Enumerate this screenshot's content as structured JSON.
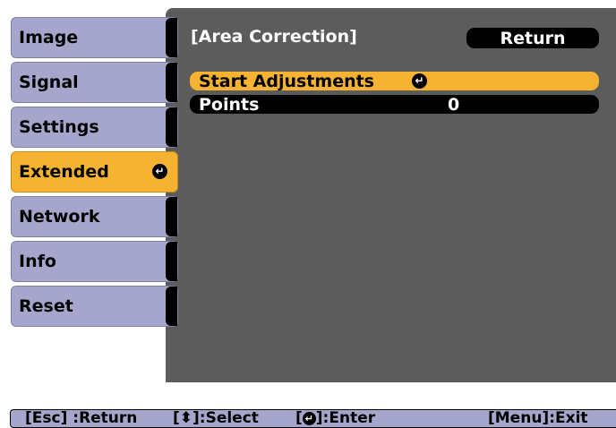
{
  "sidebar": {
    "tabs": [
      {
        "label": "Image"
      },
      {
        "label": "Signal"
      },
      {
        "label": "Settings"
      },
      {
        "label": "Extended",
        "active": true
      },
      {
        "label": "Network"
      },
      {
        "label": "Info"
      },
      {
        "label": "Reset"
      }
    ]
  },
  "panel": {
    "title": "[Area Correction]",
    "return_label": "Return",
    "rows": [
      {
        "label": "Start Adjustments",
        "value": ""
      },
      {
        "label": "Points",
        "value": "0"
      }
    ]
  },
  "help": {
    "esc": "[Esc] :Return",
    "select": "[⬍]:Select",
    "enter_prefix": "[",
    "enter_suffix": "]:Enter",
    "menu": "[Menu]:Exit"
  },
  "icons": {
    "enter": "enter-icon"
  },
  "colors": {
    "accent": "#f5b331",
    "tab": "#a6a6cc",
    "panel": "#5c5c5c"
  }
}
